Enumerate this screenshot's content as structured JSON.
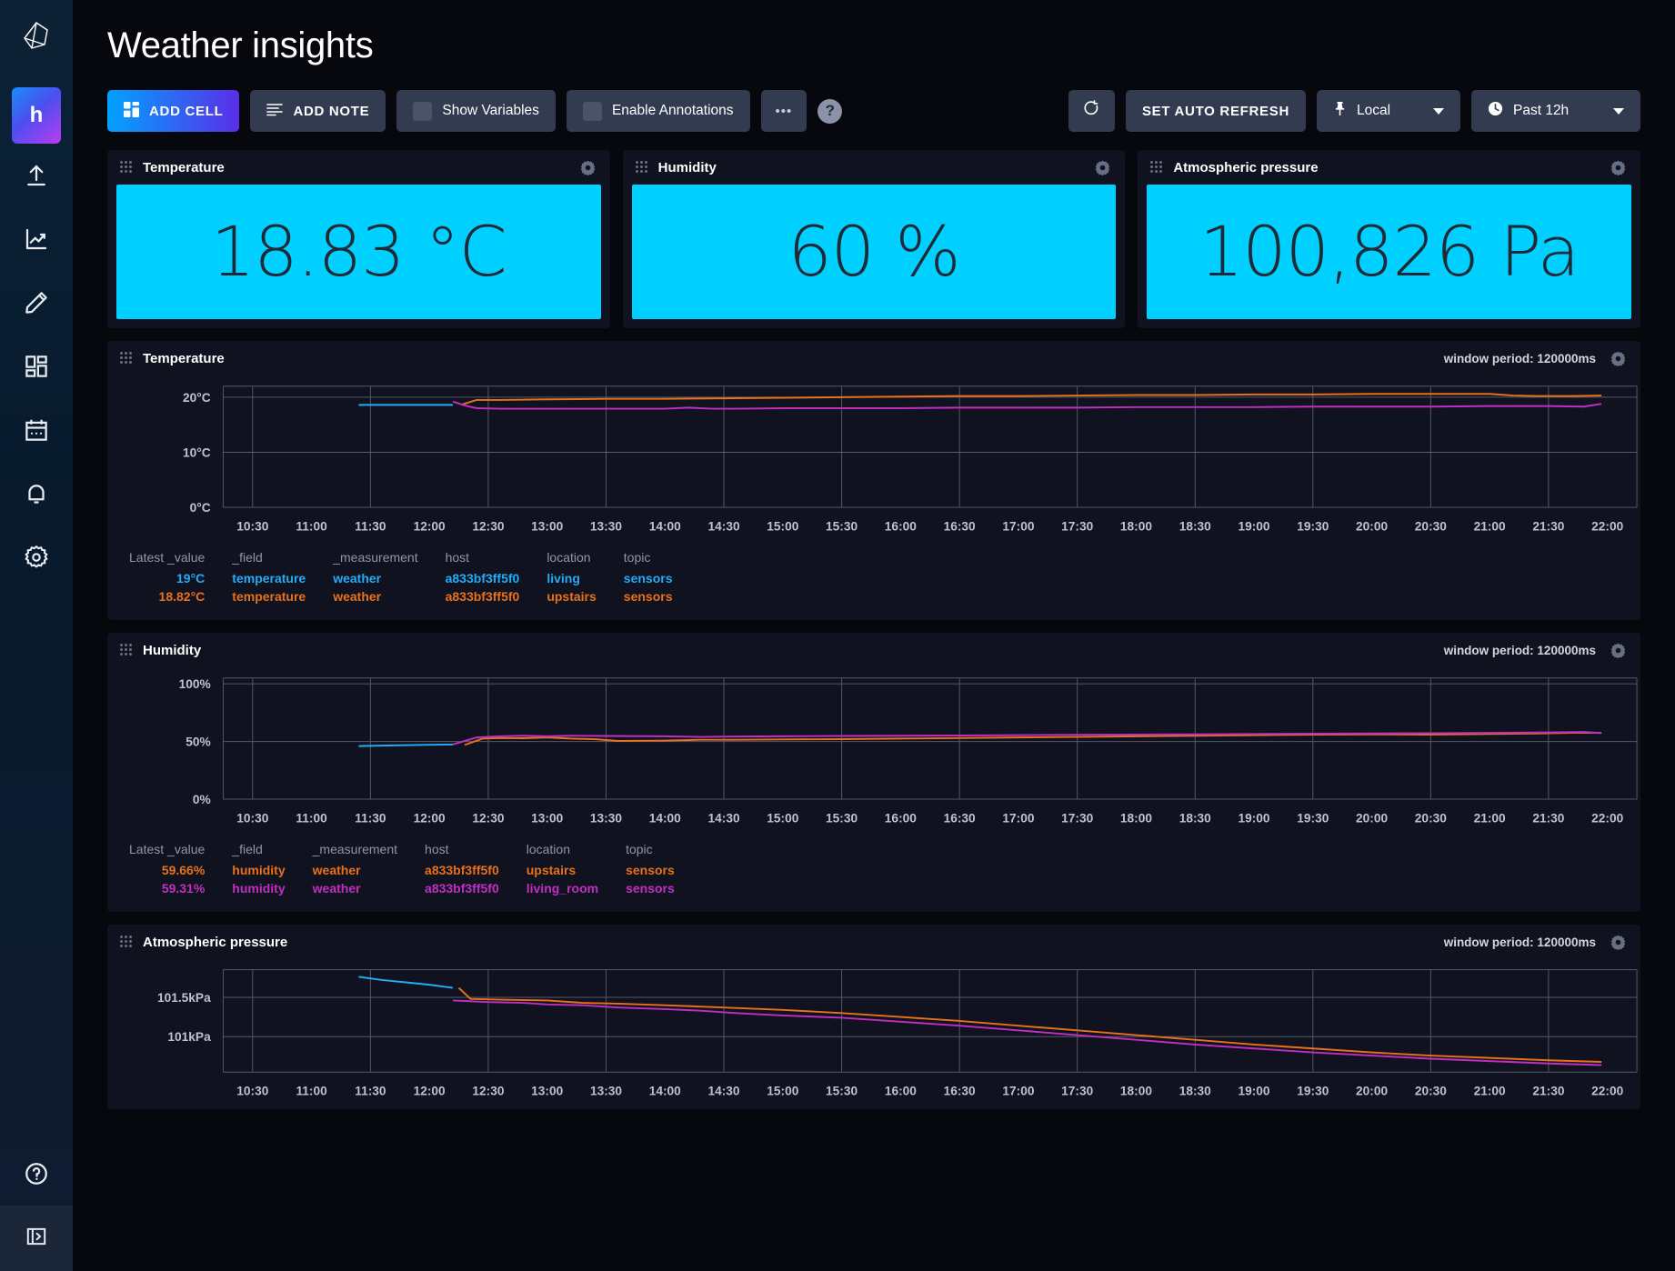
{
  "app": {
    "org_initial": "h",
    "logo_icon": "influxdb-logo-icon"
  },
  "sidebar": {
    "items": [
      {
        "name": "load-data",
        "icon": "upload-arrow-icon"
      },
      {
        "name": "data-explorer",
        "icon": "line-graph-icon"
      },
      {
        "name": "notebooks",
        "icon": "pencil-icon"
      },
      {
        "name": "dashboards",
        "icon": "dashboard-grid-icon"
      },
      {
        "name": "tasks",
        "icon": "calendar-icon"
      },
      {
        "name": "alerts",
        "icon": "bell-icon"
      },
      {
        "name": "settings",
        "icon": "gear-icon"
      }
    ],
    "help_icon": "question-circle-icon",
    "collapse_icon": "panel-expand-icon"
  },
  "header": {
    "title": "Weather insights"
  },
  "toolbar": {
    "add_cell_label": "ADD CELL",
    "add_cell_icon": "grid-squares-icon",
    "add_note_label": "ADD NOTE",
    "add_note_icon": "note-lines-icon",
    "show_variables_label": "Show Variables",
    "enable_annotations_label": "Enable Annotations",
    "more_label": "•••",
    "help_label": "?",
    "refresh_icon": "refresh-icon",
    "set_auto_refresh_label": "SET AUTO REFRESH",
    "timezone_label": "Local",
    "timezone_icon": "pin-icon",
    "time_range_label": "Past 12h",
    "time_range_icon": "clock-icon"
  },
  "colors": {
    "gauge_background": "#00d0ff",
    "gauge_text": "#202a36",
    "series_blue": "#22adf6",
    "series_orange": "#e8711a",
    "series_magenta": "#bf2fc2",
    "accent_gradient_start": "#00a3ff",
    "accent_gradient_end": "#5a2ee8"
  },
  "gauges": [
    {
      "title": "Temperature",
      "value": "18.83 °C"
    },
    {
      "title": "Humidity",
      "value": "60 %"
    },
    {
      "title": "Atmospheric pressure",
      "value": "100,826 Pa"
    }
  ],
  "graphs": [
    {
      "title": "Temperature",
      "window_period": "window period: 120000ms",
      "legend": {
        "headers": [
          "Latest _value",
          "_field",
          "_measurement",
          "host",
          "location",
          "topic"
        ],
        "rows": [
          {
            "color": "#22adf6",
            "cells": [
              "19°C",
              "temperature",
              "weather",
              "a833bf3ff5f0",
              "living",
              "sensors"
            ]
          },
          {
            "color": "#e8711a",
            "cells": [
              "18.82°C",
              "temperature",
              "weather",
              "a833bf3ff5f0",
              "upstairs",
              "sensors"
            ]
          }
        ]
      }
    },
    {
      "title": "Humidity",
      "window_period": "window period: 120000ms",
      "legend": {
        "headers": [
          "Latest _value",
          "_field",
          "_measurement",
          "host",
          "location",
          "topic"
        ],
        "rows": [
          {
            "color": "#e8711a",
            "cells": [
              "59.66%",
              "humidity",
              "weather",
              "a833bf3ff5f0",
              "upstairs",
              "sensors"
            ]
          },
          {
            "color": "#bf2fc2",
            "cells": [
              "59.31%",
              "humidity",
              "weather",
              "a833bf3ff5f0",
              "living_room",
              "sensors"
            ]
          }
        ]
      }
    },
    {
      "title": "Atmospheric pressure",
      "window_period": "window period: 120000ms"
    }
  ],
  "chart_data": [
    {
      "type": "line",
      "title": "Temperature",
      "ylabel": "",
      "xlabel": "",
      "ylim": [
        0,
        22
      ],
      "yticks": [
        0,
        10,
        20
      ],
      "ytick_labels": [
        "0°C",
        "10°C",
        "20°C"
      ],
      "grid": true,
      "x": [
        "10:30",
        "11:00",
        "11:30",
        "12:00",
        "12:30",
        "13:00",
        "13:30",
        "14:00",
        "14:30",
        "15:00",
        "15:30",
        "16:00",
        "16:30",
        "17:00",
        "17:30",
        "18:00",
        "18:30",
        "19:00",
        "19:30",
        "20:00",
        "20:30",
        "21:00",
        "21:30",
        "22:00"
      ],
      "series": [
        {
          "name": "living",
          "color": "#22adf6",
          "x": [
            11.4,
            11.6,
            11.8,
            12.0,
            12.2
          ],
          "values": [
            18.6,
            18.6,
            18.6,
            18.6,
            18.6
          ]
        },
        {
          "name": "upstairs",
          "color": "#e8711a",
          "x": [
            12.28,
            12.4,
            12.6,
            13.0,
            13.5,
            14.0,
            14.5,
            15.0,
            15.5,
            16.0,
            16.5,
            17.0,
            17.5,
            18.0,
            18.5,
            19.0,
            19.5,
            20.0,
            20.5,
            21.0,
            21.2,
            21.4,
            21.7,
            21.95
          ],
          "values": [
            18.7,
            19.5,
            19.5,
            19.6,
            19.7,
            19.7,
            19.8,
            19.9,
            20.0,
            20.1,
            20.2,
            20.2,
            20.3,
            20.4,
            20.4,
            20.5,
            20.5,
            20.6,
            20.6,
            20.6,
            20.3,
            20.2,
            20.2,
            20.3
          ]
        },
        {
          "name": "living_room",
          "color": "#bf2fc2",
          "x": [
            12.2,
            12.3,
            12.4,
            12.6,
            13.0,
            13.5,
            14.0,
            14.2,
            14.4,
            14.6,
            15.0,
            15.5,
            16.0,
            16.5,
            17.0,
            17.5,
            18.0,
            18.5,
            19.0,
            19.5,
            20.0,
            20.5,
            21.0,
            21.5,
            21.8,
            21.95
          ],
          "values": [
            19.2,
            18.5,
            18.0,
            17.9,
            17.9,
            17.9,
            17.9,
            18.1,
            17.9,
            17.9,
            18.0,
            18.0,
            18.0,
            18.1,
            18.1,
            18.1,
            18.2,
            18.2,
            18.2,
            18.3,
            18.3,
            18.3,
            18.4,
            18.4,
            18.3,
            18.8
          ]
        }
      ]
    },
    {
      "type": "line",
      "title": "Humidity",
      "ylim": [
        0,
        105
      ],
      "yticks": [
        0,
        50,
        100
      ],
      "ytick_labels": [
        "0%",
        "50%",
        "100%"
      ],
      "grid": true,
      "x": [
        "10:30",
        "11:00",
        "11:30",
        "12:00",
        "12:30",
        "13:00",
        "13:30",
        "14:00",
        "14:30",
        "15:00",
        "15:30",
        "16:00",
        "16:30",
        "17:00",
        "17:30",
        "18:00",
        "18:30",
        "19:00",
        "19:30",
        "20:00",
        "20:30",
        "21:00",
        "21:30",
        "22:00"
      ],
      "series": [
        {
          "name": "living",
          "color": "#22adf6",
          "x": [
            11.4,
            11.7,
            12.0,
            12.2
          ],
          "values": [
            46.0,
            46.6,
            47.2,
            47.4
          ]
        },
        {
          "name": "upstairs",
          "color": "#e8711a",
          "x": [
            12.3,
            12.45,
            12.6,
            12.8,
            13.0,
            13.2,
            13.4,
            13.6,
            14.0,
            14.3,
            14.6,
            15.0,
            15.5,
            16.0,
            16.5,
            17.0,
            17.5,
            18.0,
            18.5,
            19.0,
            19.5,
            20.0,
            20.5,
            21.0,
            21.4,
            21.7,
            21.95
          ],
          "values": [
            47.0,
            52.5,
            53.0,
            52.8,
            53.5,
            52.5,
            52.0,
            50.5,
            50.8,
            51.5,
            51.5,
            51.8,
            52.0,
            52.5,
            53.0,
            53.5,
            54.0,
            54.5,
            55.0,
            55.5,
            56.0,
            56.2,
            56.0,
            56.5,
            57.0,
            57.5,
            57.5
          ]
        },
        {
          "name": "living_room",
          "color": "#bf2fc2",
          "x": [
            12.2,
            12.4,
            12.6,
            12.8,
            13.0,
            13.2,
            13.5,
            14.0,
            14.3,
            14.6,
            15.0,
            15.5,
            16.0,
            16.5,
            17.0,
            17.5,
            18.0,
            18.5,
            19.0,
            19.5,
            20.0,
            20.5,
            21.0,
            21.5,
            21.8,
            21.95
          ],
          "values": [
            47.5,
            53.5,
            54.5,
            55.0,
            54.5,
            55.0,
            54.8,
            54.5,
            54.0,
            54.3,
            54.5,
            54.8,
            55.0,
            55.2,
            55.5,
            55.8,
            56.0,
            56.2,
            56.5,
            56.8,
            57.0,
            57.2,
            57.5,
            57.8,
            58.2,
            57.3
          ]
        }
      ]
    },
    {
      "type": "line",
      "title": "Atmospheric pressure",
      "ylim": [
        100.55,
        101.85
      ],
      "yticks": [
        101.0,
        101.5
      ],
      "ytick_labels": [
        "101kPa",
        "101.5kPa"
      ],
      "grid": true,
      "x": [
        "10:30",
        "11:00",
        "11:30",
        "12:00",
        "12:30",
        "13:00",
        "13:30",
        "14:00",
        "14:30",
        "15:00",
        "15:30",
        "16:00",
        "16:30",
        "17:00",
        "17:30",
        "18:00",
        "18:30",
        "19:00",
        "19:30",
        "20:00",
        "20:30",
        "21:00",
        "21:30",
        "22:00"
      ],
      "series": [
        {
          "name": "living",
          "color": "#22adf6",
          "x": [
            11.4,
            11.6,
            11.8,
            12.0,
            12.2
          ],
          "values": [
            101.76,
            101.72,
            101.69,
            101.66,
            101.62
          ]
        },
        {
          "name": "upstairs",
          "color": "#e8711a",
          "x": [
            12.25,
            12.35,
            12.6,
            13.0,
            13.3,
            13.6,
            14.0,
            14.5,
            15.0,
            15.5,
            16.0,
            16.5,
            17.0,
            17.5,
            18.0,
            18.5,
            19.0,
            19.5,
            20.0,
            20.5,
            21.0,
            21.5,
            21.95
          ],
          "values": [
            101.62,
            101.48,
            101.47,
            101.46,
            101.43,
            101.42,
            101.4,
            101.37,
            101.34,
            101.3,
            101.25,
            101.2,
            101.14,
            101.08,
            101.02,
            100.96,
            100.9,
            100.85,
            100.8,
            100.76,
            100.73,
            100.7,
            100.68
          ]
        },
        {
          "name": "living_room",
          "color": "#bf2fc2",
          "x": [
            12.2,
            12.5,
            12.8,
            13.0,
            13.3,
            13.6,
            14.0,
            14.3,
            14.6,
            15.0,
            15.5,
            16.0,
            16.5,
            17.0,
            17.5,
            18.0,
            18.5,
            19.0,
            19.5,
            20.0,
            20.5,
            21.0,
            21.5,
            21.95
          ],
          "values": [
            101.46,
            101.44,
            101.43,
            101.41,
            101.4,
            101.37,
            101.35,
            101.33,
            101.3,
            101.27,
            101.24,
            101.19,
            101.14,
            101.08,
            101.02,
            100.96,
            100.9,
            100.85,
            100.8,
            100.76,
            100.72,
            100.69,
            100.66,
            100.64
          ]
        }
      ]
    }
  ]
}
